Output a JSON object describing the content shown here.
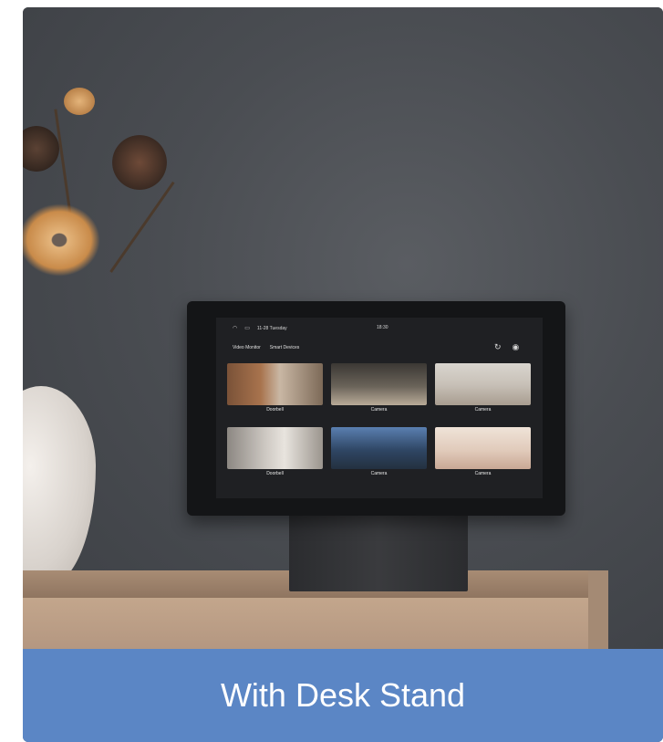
{
  "tablet_ui": {
    "status_date": "11-28 Tuesday",
    "status_time": "18:30",
    "tabs": [
      "Video Monitor",
      "Smart Devices"
    ],
    "tiles": [
      {
        "label": "Doorbell"
      },
      {
        "label": "Camera"
      },
      {
        "label": "Camera"
      },
      {
        "label": "Doorbell"
      },
      {
        "label": "Camera"
      },
      {
        "label": "Camera"
      }
    ],
    "icons": [
      "wifi-icon",
      "battery-icon",
      "refresh-icon",
      "eye-icon"
    ]
  },
  "caption": {
    "text": "With Desk Stand",
    "background_color": "#5b86c5",
    "text_color": "#ffffff"
  }
}
